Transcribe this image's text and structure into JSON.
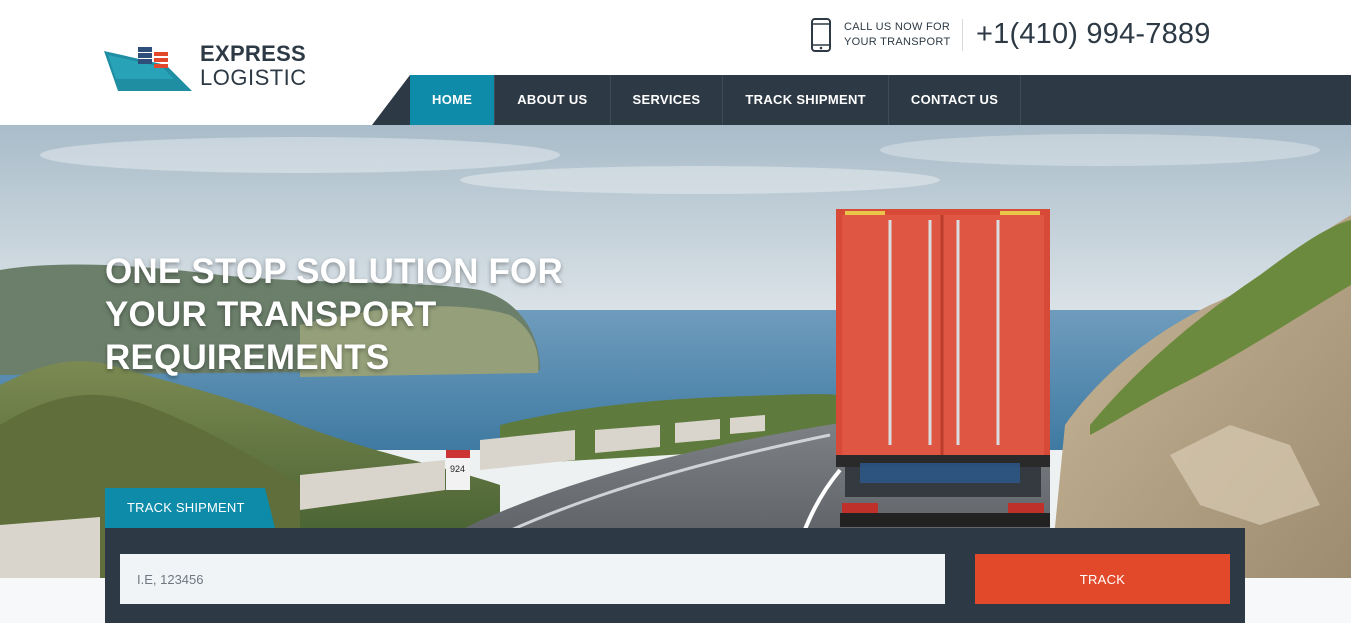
{
  "brand": {
    "line1": "EXPRESS",
    "line2": "LOGISTIC",
    "colors": {
      "dark": "#2d3a45",
      "teal": "#0e8ba8",
      "accent": "#e1492a"
    }
  },
  "contact": {
    "call_label_line1": "CALL US NOW FOR",
    "call_label_line2": "YOUR TRANSPORT",
    "phone_number": "+1(410) 994-7889",
    "icon": "mobile-phone-icon"
  },
  "nav": {
    "items": [
      {
        "label": "HOME",
        "active": true
      },
      {
        "label": "ABOUT US",
        "active": false
      },
      {
        "label": "SERVICES",
        "active": false
      },
      {
        "label": "TRACK SHIPMENT",
        "active": false
      },
      {
        "label": "CONTACT US",
        "active": false
      }
    ]
  },
  "hero": {
    "title_line1": "ONE STOP SOLUTION FOR",
    "title_line2": "YOUR TRANSPORT",
    "title_line3": "REQUIREMENTS",
    "road_marker": "924"
  },
  "tracking": {
    "tab_label": "TRACK SHIPMENT",
    "input_placeholder": "I.E, 123456",
    "input_value": "",
    "button_label": "TRACK"
  }
}
